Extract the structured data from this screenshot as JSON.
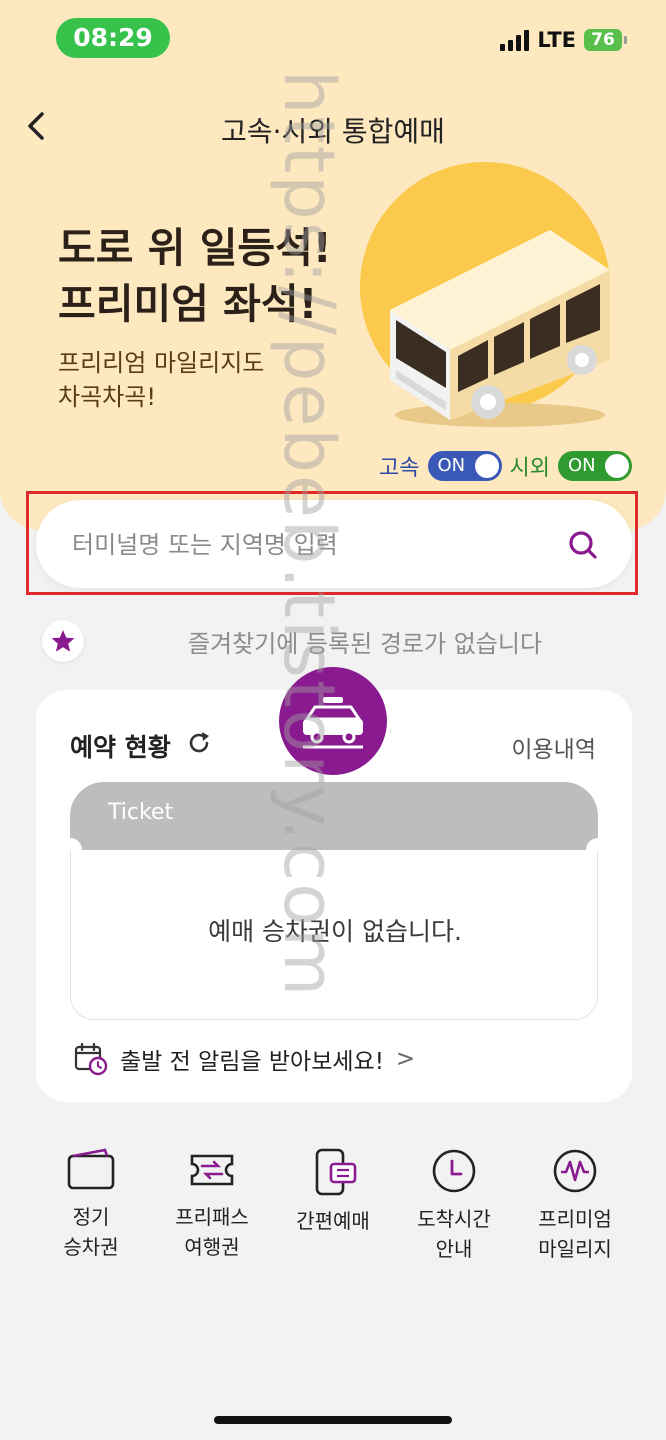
{
  "status": {
    "time": "08:29",
    "network": "LTE",
    "battery": "76"
  },
  "header": {
    "title": "고속·시외 통합예매",
    "back_icon": "chevron-left-icon"
  },
  "banner": {
    "headline_line1": "도로 위 일등석!",
    "headline_line2": "프리미엄 좌석!",
    "sub_line1": "프리리엄 마일리지도",
    "sub_line2": "차곡차곡!"
  },
  "toggles": {
    "express": {
      "label": "고속",
      "state": "ON"
    },
    "intercity": {
      "label": "시외",
      "state": "ON"
    }
  },
  "search": {
    "placeholder": "터미널명 또는 지역명 입력",
    "icon": "search-icon"
  },
  "favorites": {
    "empty_text": "즐겨찾기에 등록된 경로가 없습니다"
  },
  "reservation": {
    "title": "예약 현황",
    "history_link": "이용내역",
    "ticket_label": "Ticket",
    "empty_text": "예매 승차권이 없습니다.",
    "alarm_text": "출발 전 알림을 받아보세요!",
    "alarm_chevron": ">"
  },
  "menu": [
    {
      "line1": "정기",
      "line2": "승차권",
      "icon": "wallet-ticket-icon"
    },
    {
      "line1": "프리패스",
      "line2": "여행권",
      "icon": "freepass-ticket-icon"
    },
    {
      "line1": "간편예매",
      "line2": "",
      "icon": "phone-ticket-icon"
    },
    {
      "line1": "도착시간",
      "line2": "안내",
      "icon": "clock-icon"
    },
    {
      "line1": "프리미엄",
      "line2": "마일리지",
      "icon": "mileage-icon"
    }
  ],
  "watermark": "https://pebeb.tistory.com",
  "colors": {
    "accent": "#8a1a8f",
    "banner": "#fde8c0",
    "express_toggle": "#3a59b6",
    "intercity_toggle": "#2f9a2f"
  }
}
